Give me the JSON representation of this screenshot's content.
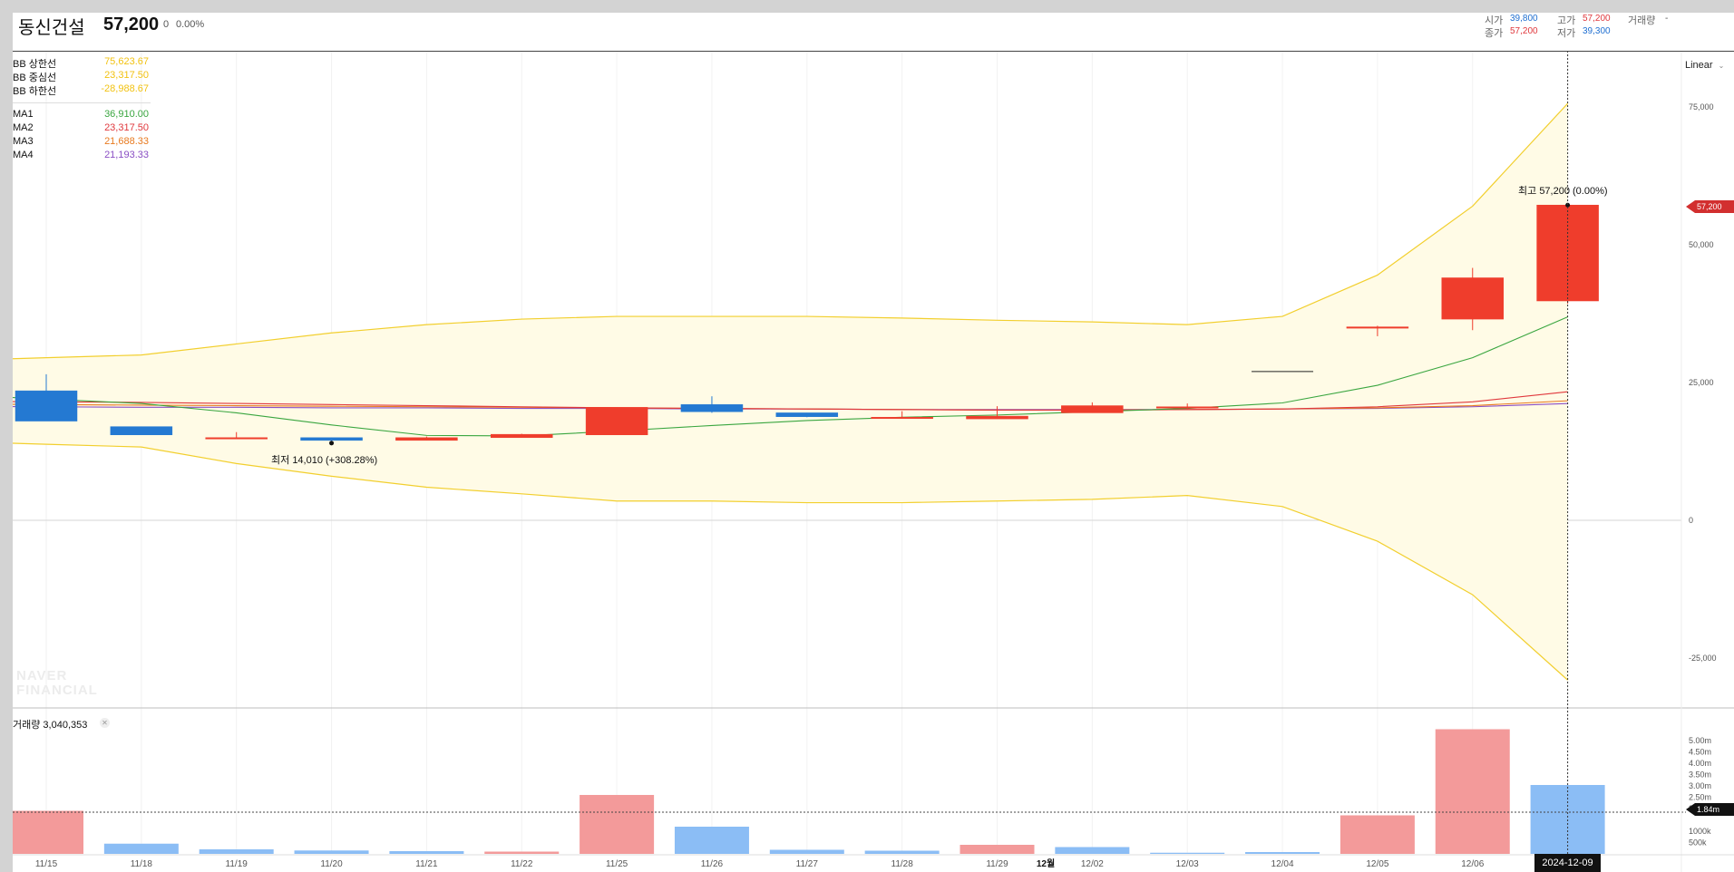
{
  "header": {
    "name": "동신건설",
    "price": "57,200",
    "change": "0",
    "change_pct": "0.00%",
    "ohlc": {
      "open_label": "시가",
      "open": "39,800",
      "high_label": "고가",
      "high": "57,200",
      "volume_label": "거래량",
      "volume": "-",
      "close_label": "종가",
      "close": "57,200",
      "low_label": "저가",
      "low": "39,300"
    }
  },
  "legend": {
    "bb": [
      {
        "label": "BB 상한선",
        "value": "75,623.67",
        "color": "#f2c211"
      },
      {
        "label": "BB 중심선",
        "value": "23,317.50",
        "color": "#f2c211"
      },
      {
        "label": "BB 하한선",
        "value": "-28,988.67",
        "color": "#f2c211"
      }
    ],
    "ma": [
      {
        "label": "MA1",
        "value": "36,910.00",
        "color": "#3aa640"
      },
      {
        "label": "MA2",
        "value": "23,317.50",
        "color": "#e0383d"
      },
      {
        "label": "MA3",
        "value": "21,688.33",
        "color": "#e87a1f"
      },
      {
        "label": "MA4",
        "value": "21,193.33",
        "color": "#8a4fc4"
      }
    ]
  },
  "scale_mode": "Linear",
  "current_price_badge": "57,200",
  "current_volume_badge": "1.84m",
  "volume_label": "거래량 3,040,353",
  "volume_close_icon": "close-icon",
  "crosshair_date": "2024-12-09",
  "month_marker": "12월",
  "watermark": [
    "NAVER",
    "FINANCIAL"
  ],
  "annotations": {
    "high": {
      "label": "최고",
      "value": "57,200 (0.00%)"
    },
    "low": {
      "label": "최저",
      "value": "14,010 (+308.28%)"
    }
  },
  "colors": {
    "up": "#ef3d2c",
    "down": "#2479d2",
    "vol_up": "#f39a9a",
    "vol_down": "#8bbdf5",
    "bb": "#f2cf2e",
    "bb_fill": "#fffbe6"
  },
  "chart_data": {
    "type": "candlestick",
    "categories": [
      "11/15",
      "11/18",
      "11/19",
      "11/20",
      "11/21",
      "11/22",
      "11/25",
      "11/26",
      "11/27",
      "11/28",
      "11/29",
      "12/02",
      "12/03",
      "12/04",
      "12/05",
      "12/06",
      "2024-12-09"
    ],
    "x_tick_labels": [
      "11/15",
      "11/18",
      "11/19",
      "11/20",
      "11/21",
      "11/22",
      "11/25",
      "11/26",
      "11/27",
      "11/28",
      "11/29",
      "12월",
      "12/02",
      "12/03",
      "12/04",
      "12/05",
      "12/06"
    ],
    "ohlc": [
      {
        "o": 23500,
        "h": 26500,
        "l": 18000,
        "c": 18000
      },
      {
        "o": 17000,
        "h": 17000,
        "l": 15500,
        "c": 15500
      },
      {
        "o": 15000,
        "h": 16000,
        "l": 14900,
        "c": 15000
      },
      {
        "o": 15000,
        "h": 15000,
        "l": 14010,
        "c": 14500
      },
      {
        "o": 14500,
        "h": 15200,
        "l": 14500,
        "c": 15000
      },
      {
        "o": 15000,
        "h": 15700,
        "l": 15000,
        "c": 15600
      },
      {
        "o": 15500,
        "h": 20500,
        "l": 15500,
        "c": 20500
      },
      {
        "o": 21000,
        "h": 22500,
        "l": 19500,
        "c": 19700
      },
      {
        "o": 19500,
        "h": 19500,
        "l": 18700,
        "c": 18800
      },
      {
        "o": 18700,
        "h": 19800,
        "l": 18500,
        "c": 18700
      },
      {
        "o": 18400,
        "h": 20700,
        "l": 18400,
        "c": 18900
      },
      {
        "o": 19500,
        "h": 21400,
        "l": 19500,
        "c": 20800
      },
      {
        "o": 20500,
        "h": 21200,
        "l": 20200,
        "c": 20600
      },
      {
        "o": 27000,
        "h": 27000,
        "l": 27000,
        "c": 27000
      },
      {
        "o": 35100,
        "h": 35300,
        "l": 33400,
        "c": 35100
      },
      {
        "o": 36500,
        "h": 45800,
        "l": 34500,
        "c": 44000
      },
      {
        "o": 39800,
        "h": 57200,
        "l": 39300,
        "c": 57200
      }
    ],
    "volume": [
      1.9,
      0.45,
      0.2,
      0.15,
      0.12,
      0.1,
      2.6,
      1.2,
      0.18,
      0.14,
      0.4,
      0.3,
      0.05,
      0.08,
      1.7,
      5.5,
      3.04
    ],
    "volume_direction": [
      "up",
      "down",
      "down",
      "down",
      "down",
      "up",
      "up",
      "down",
      "down",
      "down",
      "up",
      "down",
      "down",
      "down",
      "up",
      "up",
      "down"
    ],
    "indicators": {
      "bb_upper": [
        29500,
        30000,
        32000,
        34000,
        35500,
        36500,
        37000,
        37000,
        37000,
        36700,
        36300,
        36000,
        35500,
        37000,
        44500,
        57000,
        75623.67
      ],
      "bb_lower": [
        13800,
        13300,
        10300,
        8000,
        6000,
        4800,
        3500,
        3500,
        3200,
        3200,
        3500,
        3800,
        4500,
        2500,
        -3800,
        -13500,
        -28988.67
      ],
      "ma1": [
        22000,
        21200,
        19500,
        17300,
        15400,
        15300,
        16200,
        17200,
        18100,
        18700,
        19100,
        19700,
        20300,
        21300,
        24500,
        29500,
        36910
      ],
      "ma2": [
        21500,
        21400,
        21200,
        21000,
        20800,
        20600,
        20400,
        20300,
        20200,
        20100,
        20000,
        20000,
        20100,
        20200,
        20600,
        21500,
        23317.5
      ],
      "ma3": [
        21000,
        20900,
        20800,
        20700,
        20600,
        20500,
        20400,
        20300,
        20200,
        20100,
        20000,
        20000,
        20100,
        20200,
        20400,
        20800,
        21688.33
      ],
      "ma4": [
        20600,
        20500,
        20500,
        20400,
        20400,
        20300,
        20300,
        20200,
        20200,
        20100,
        20100,
        20100,
        20100,
        20200,
        20300,
        20600,
        21193.33
      ]
    },
    "y_axis": {
      "ticks": [
        "75,000",
        "50,000",
        "25,000",
        "0",
        "-25,000"
      ],
      "tick_values": [
        75000,
        50000,
        25000,
        0,
        -25000
      ],
      "ylim": [
        -34000,
        85000
      ],
      "scale": "linear"
    },
    "volume_axis": {
      "ticks": [
        "5.00m",
        "4.50m",
        "4.00m",
        "3.50m",
        "3.00m",
        "2.50m",
        "2.00m",
        "1000k",
        "500k"
      ],
      "tick_values": [
        5.0,
        4.5,
        4.0,
        3.5,
        3.0,
        2.5,
        2.0,
        1.0,
        0.5
      ],
      "ylim": [
        0,
        5.6
      ]
    },
    "legend_position": "top-left",
    "grid": true
  }
}
